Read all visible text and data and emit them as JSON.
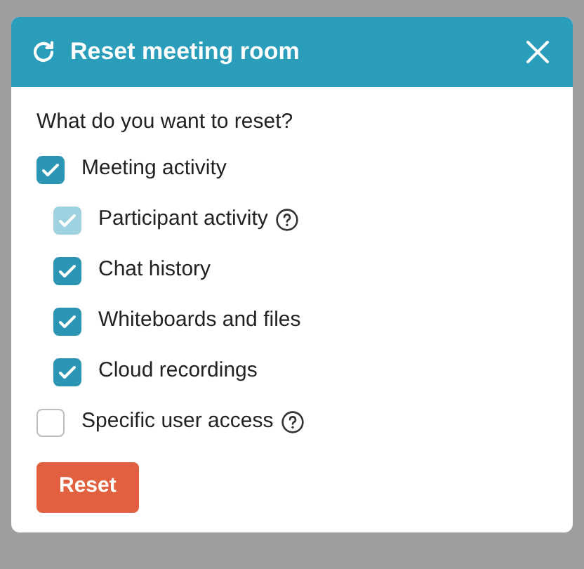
{
  "dialog": {
    "title": "Reset meeting room",
    "question": "What do you want to reset?",
    "options": [
      {
        "label": "Meeting activity",
        "checked": true,
        "disabled": false,
        "help": false,
        "children": [
          {
            "label": "Participant activity",
            "checked": true,
            "disabled": true,
            "help": true
          },
          {
            "label": "Chat history",
            "checked": true,
            "disabled": false,
            "help": false
          },
          {
            "label": "Whiteboards and files",
            "checked": true,
            "disabled": false,
            "help": false
          },
          {
            "label": "Cloud recordings",
            "checked": true,
            "disabled": false,
            "help": false
          }
        ]
      },
      {
        "label": "Specific user access",
        "checked": false,
        "disabled": false,
        "help": true
      }
    ],
    "button": "Reset"
  }
}
